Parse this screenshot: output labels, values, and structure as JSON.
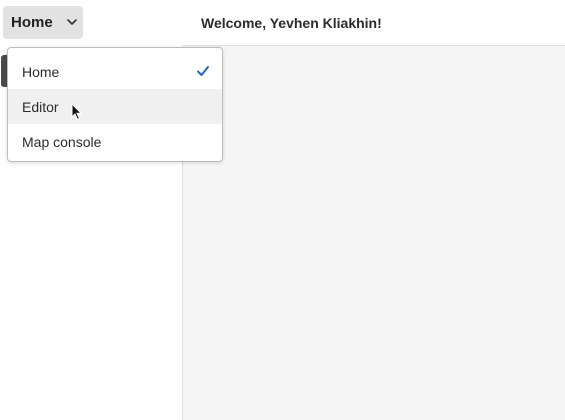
{
  "switcher": {
    "selected": "Home",
    "icon": "chevron-down-icon"
  },
  "header": {
    "welcome": "Welcome, Yevhen Kliakhin!"
  },
  "menu": {
    "items": [
      {
        "label": "Home",
        "selected": true
      },
      {
        "label": "Editor",
        "selected": false
      },
      {
        "label": "Map console",
        "selected": false
      }
    ],
    "check_icon": "checkmark-icon",
    "check_color": "#2b62c9"
  },
  "colors": {
    "switcher_bg": "#e2e2e2",
    "hover_bg": "#f0f0f0",
    "content_bg": "#f5f5f5"
  }
}
